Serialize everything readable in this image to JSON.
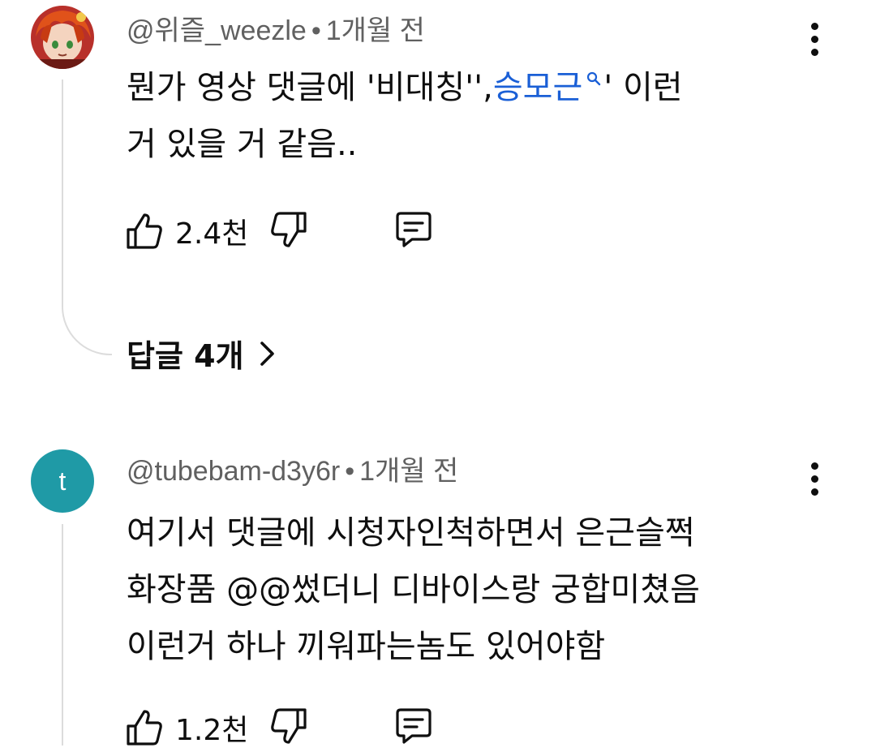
{
  "comments": [
    {
      "author": "@위즐_weezle",
      "separator": "•",
      "time": "1개월 전",
      "text_line1_prefix": "뭔가 영상 댓글에 '비대칭'',",
      "text_line1_link": "승모근",
      "text_line1_suffix": "' 이런",
      "text_line2": "거 있을 거 같음..",
      "likes": "2.4천",
      "replies_label": "답글 4개",
      "avatar_icon": "anime-avatar-icon"
    },
    {
      "author": "@tubebam-d3y6r",
      "separator": "•",
      "time": "1개월 전",
      "avatar_letter": "t",
      "text_line1": "여기서 댓글에 시청자인척하면서 은근슬쩍",
      "text_line2": "화장품 @@썼더니 디바이스랑 궁합미쳤음",
      "text_line3": "이런거 하나 끼워파는놈도 있어야함",
      "likes": "1.2천"
    }
  ],
  "colors": {
    "link": "#1a5fd6",
    "meta": "#606060",
    "avatar_t_bg": "#1f9aa6",
    "thread_line": "#dcdcdc"
  },
  "icons": {
    "like": "thumbs-up-icon",
    "dislike": "thumbs-down-icon",
    "reply": "comment-reply-icon",
    "menu": "more-vertical-icon",
    "chevron": "chevron-right-icon",
    "search": "search-icon"
  }
}
